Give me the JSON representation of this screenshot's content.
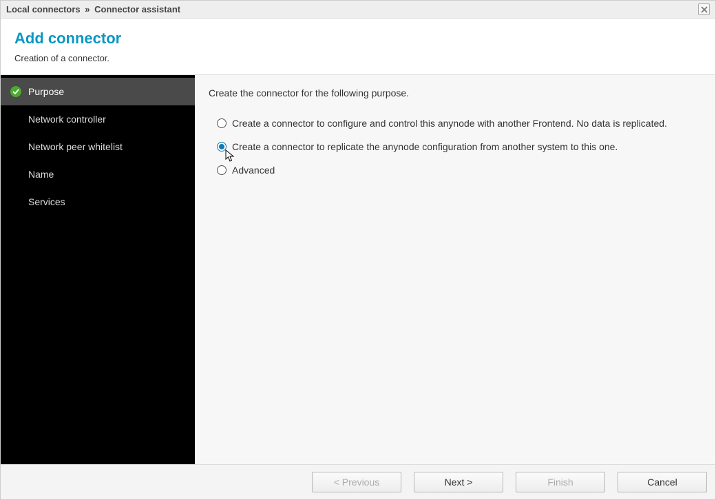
{
  "titlebar": {
    "crumb1": "Local connectors",
    "sep": "»",
    "crumb2": "Connector assistant"
  },
  "header": {
    "title": "Add connector",
    "subtitle": "Creation of a connector."
  },
  "sidebar": {
    "items": [
      {
        "label": "Purpose",
        "active": true,
        "checked": true
      },
      {
        "label": "Network controller",
        "active": false,
        "checked": false
      },
      {
        "label": "Network peer whitelist",
        "active": false,
        "checked": false
      },
      {
        "label": "Name",
        "active": false,
        "checked": false
      },
      {
        "label": "Services",
        "active": false,
        "checked": false
      }
    ]
  },
  "content": {
    "intro": "Create the connector for the following purpose.",
    "options": [
      {
        "label": "Create a connector to configure and control this anynode with another Frontend. No data is replicated.",
        "selected": false
      },
      {
        "label": "Create a connector to replicate the anynode configuration from another system to this one.",
        "selected": true
      },
      {
        "label": "Advanced",
        "selected": false
      }
    ]
  },
  "footer": {
    "previous": "< Previous",
    "next": "Next >",
    "finish": "Finish",
    "cancel": "Cancel",
    "previous_enabled": false,
    "next_enabled": true,
    "finish_enabled": false,
    "cancel_enabled": true
  }
}
